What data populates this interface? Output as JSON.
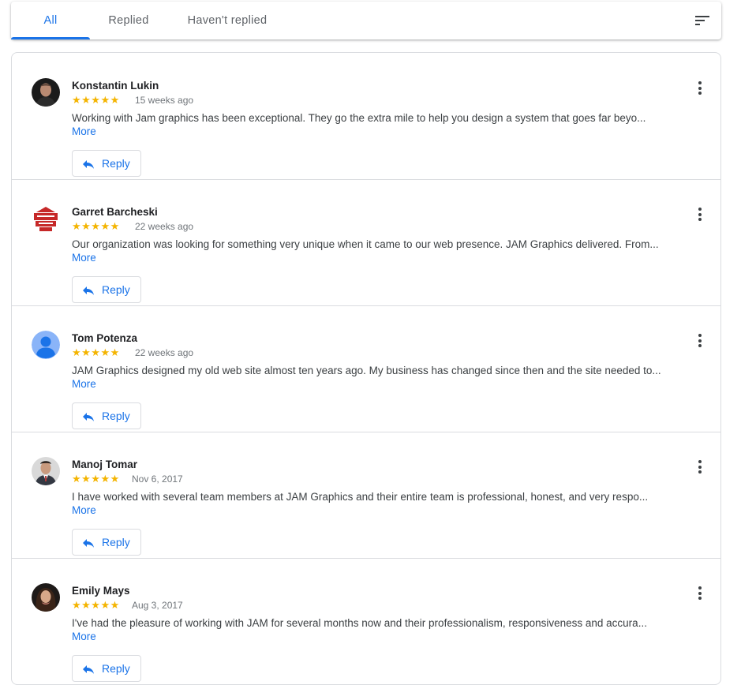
{
  "tabs": {
    "all": "All",
    "replied": "Replied",
    "not_replied": "Haven't replied"
  },
  "sort_icon": "sort-icon",
  "reply_label": "Reply",
  "more_label": "More",
  "colors": {
    "accent": "#1a73e8",
    "star": "#f4b400",
    "border": "#dadce0"
  },
  "reviews": [
    {
      "name": "Konstantin Lukin",
      "stars": "★★★★★",
      "rating": 5,
      "time": "15 weeks ago",
      "text": "Working with Jam graphics has been exceptional. They go the extra mile to help you design a system that goes far beyo...",
      "avatar": "photo"
    },
    {
      "name": "Garret Barcheski",
      "stars": "★★★★★",
      "rating": 5,
      "time": "22 weeks ago",
      "text": "Our organization was looking for something very unique when it came to our web presence. JAM Graphics delivered. From...",
      "avatar": "logo"
    },
    {
      "name": "Tom Potenza",
      "stars": "★★★★★",
      "rating": 5,
      "time": "22 weeks ago",
      "text": "JAM Graphics designed my old web site almost ten years ago. My business has changed since then and the site needed to...",
      "avatar": "default"
    },
    {
      "name": "Manoj Tomar",
      "stars": "★★★★★",
      "rating": 5,
      "time": "Nov 6, 2017",
      "text": "I have worked with several team members at JAM Graphics and their entire team is professional, honest, and very respo...",
      "avatar": "photo"
    },
    {
      "name": "Emily Mays",
      "stars": "★★★★★",
      "rating": 5,
      "time": "Aug 3, 2017",
      "text": "I've had the pleasure of working with JAM for several months now and their professionalism, responsiveness and accura...",
      "avatar": "photo"
    }
  ]
}
